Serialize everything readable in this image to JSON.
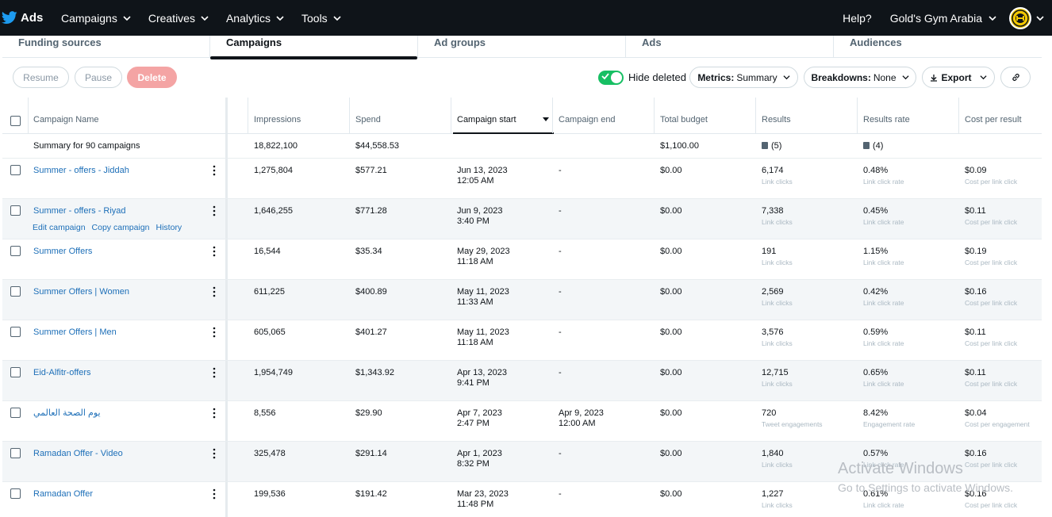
{
  "nav": {
    "brand": "Ads",
    "items": [
      "Campaigns",
      "Creatives",
      "Analytics",
      "Tools"
    ],
    "help": "Help?",
    "account": "Gold's Gym Arabia"
  },
  "tabs": [
    "Funding sources",
    "Campaigns",
    "Ad groups",
    "Ads",
    "Audiences"
  ],
  "active_tab": "Campaigns",
  "toolbar": {
    "resume": "Resume",
    "pause": "Pause",
    "delete": "Delete",
    "hide_deleted": "Hide deleted",
    "hide_deleted_on": true,
    "metrics_label": "Metrics:",
    "metrics_value": "Summary",
    "breakdowns_label": "Breakdowns:",
    "breakdowns_value": "None",
    "export": "Export"
  },
  "table": {
    "headers": [
      "Campaign Name",
      "Impressions",
      "Spend",
      "Campaign start",
      "Campaign end",
      "Total budget",
      "Results",
      "Results rate",
      "Cost per result"
    ],
    "sorted_column": "Campaign start",
    "summary": {
      "name": "Summary for 90 campaigns",
      "impressions": "18,822,100",
      "spend": "$44,558.53",
      "budget": "$1,100.00",
      "results": "(5)",
      "results_rate": "(4)"
    },
    "row_actions": [
      "Edit campaign",
      "Copy campaign",
      "History"
    ],
    "rows": [
      {
        "name": "Summer - offers - Jiddah",
        "impressions": "1,275,804",
        "spend": "$577.21",
        "start_date": "Jun 13, 2023",
        "start_time": "12:05 AM",
        "end_date": "-",
        "end_time": "",
        "budget": "$0.00",
        "results": "6,174",
        "results_label": "Link clicks",
        "rate": "0.48%",
        "rate_label": "Link click rate",
        "cost": "$0.09",
        "cost_label": "Cost per link click"
      },
      {
        "name": "Summer - offers - Riyad",
        "impressions": "1,646,255",
        "spend": "$771.28",
        "start_date": "Jun 9, 2023",
        "start_time": "3:40 PM",
        "end_date": "-",
        "end_time": "",
        "budget": "$0.00",
        "results": "7,338",
        "results_label": "Link clicks",
        "rate": "0.45%",
        "rate_label": "Link click rate",
        "cost": "$0.11",
        "cost_label": "Cost per link click"
      },
      {
        "name": "Summer Offers",
        "impressions": "16,544",
        "spend": "$35.34",
        "start_date": "May 29, 2023",
        "start_time": "11:18 AM",
        "end_date": "-",
        "end_time": "",
        "budget": "$0.00",
        "results": "191",
        "results_label": "Link clicks",
        "rate": "1.15%",
        "rate_label": "Link click rate",
        "cost": "$0.19",
        "cost_label": "Cost per link click"
      },
      {
        "name": "Summer Offers | Women",
        "impressions": "611,225",
        "spend": "$400.89",
        "start_date": "May 11, 2023",
        "start_time": "11:33 AM",
        "end_date": "-",
        "end_time": "",
        "budget": "$0.00",
        "results": "2,569",
        "results_label": "Link clicks",
        "rate": "0.42%",
        "rate_label": "Link click rate",
        "cost": "$0.16",
        "cost_label": "Cost per link click"
      },
      {
        "name": "Summer Offers | Men",
        "impressions": "605,065",
        "spend": "$401.27",
        "start_date": "May 11, 2023",
        "start_time": "11:18 AM",
        "end_date": "-",
        "end_time": "",
        "budget": "$0.00",
        "results": "3,576",
        "results_label": "Link clicks",
        "rate": "0.59%",
        "rate_label": "Link click rate",
        "cost": "$0.11",
        "cost_label": "Cost per link click"
      },
      {
        "name": "Eid-Alfitr-offers",
        "impressions": "1,954,749",
        "spend": "$1,343.92",
        "start_date": "Apr 13, 2023",
        "start_time": "9:41 PM",
        "end_date": "-",
        "end_time": "",
        "budget": "$0.00",
        "results": "12,715",
        "results_label": "Link clicks",
        "rate": "0.65%",
        "rate_label": "Link click rate",
        "cost": "$0.11",
        "cost_label": "Cost per link click"
      },
      {
        "name": "يوم الصحة العالمي",
        "impressions": "8,556",
        "spend": "$29.90",
        "start_date": "Apr 7, 2023",
        "start_time": "2:47 PM",
        "end_date": "Apr 9, 2023",
        "end_time": "12:00 AM",
        "budget": "$0.00",
        "results": "720",
        "results_label": "Tweet engagements",
        "rate": "8.42%",
        "rate_label": "Engagement rate",
        "cost": "$0.04",
        "cost_label": "Cost per engagement"
      },
      {
        "name": "Ramadan Offer - Video",
        "impressions": "325,478",
        "spend": "$291.14",
        "start_date": "Apr 1, 2023",
        "start_time": "8:32 PM",
        "end_date": "-",
        "end_time": "",
        "budget": "$0.00",
        "results": "1,840",
        "results_label": "Link clicks",
        "rate": "0.57%",
        "rate_label": "Link click rate",
        "cost": "$0.16",
        "cost_label": "Cost per link click"
      },
      {
        "name": "Ramadan Offer",
        "impressions": "199,536",
        "spend": "$191.42",
        "start_date": "Mar 23, 2023",
        "start_time": "11:48 PM",
        "end_date": "-",
        "end_time": "",
        "budget": "$0.00",
        "results": "1,227",
        "results_label": "Link clicks",
        "rate": "0.61%",
        "rate_label": "Link click rate",
        "cost": "$0.16",
        "cost_label": "Cost per link click"
      }
    ]
  },
  "watermark": {
    "line1": "Activate Windows",
    "line2": "Go to Settings to activate Windows."
  },
  "colors": {
    "nav_bg": "#0f1419",
    "link": "#1d6fb8",
    "toggle_on": "#17bf63",
    "delete_btn": "#f4a4a4"
  }
}
